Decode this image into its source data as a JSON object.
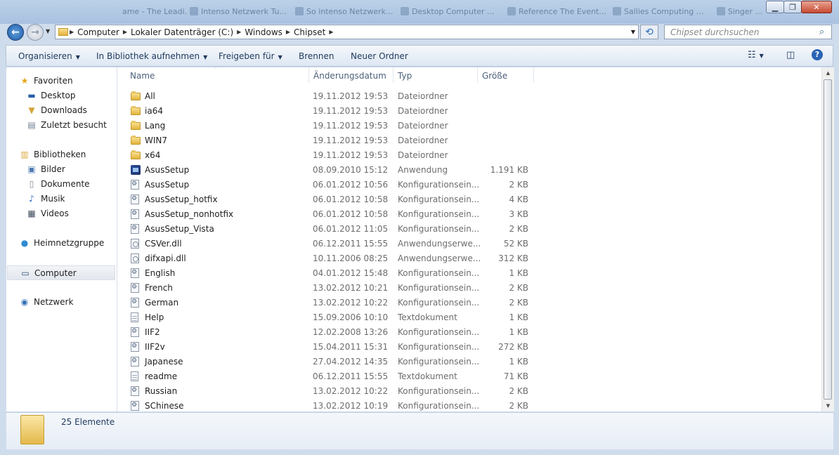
{
  "background_tabs": [
    "ame - The Leadi...",
    "Intenso Netzwerk Tu...",
    "So intenso Netzwerk...",
    "Desktop Computer ...",
    "Reference The Event...",
    "Sallies Computing ...",
    "Singer ..."
  ],
  "address": {
    "crumbs": [
      "Computer",
      "Lokaler Datenträger (C:)",
      "Windows",
      "Chipset"
    ],
    "search_placeholder": "Chipset durchsuchen"
  },
  "toolbar": {
    "organize": "Organisieren",
    "include_library": "In Bibliothek aufnehmen",
    "share": "Freigeben für",
    "burn": "Brennen",
    "new_folder": "Neuer Ordner"
  },
  "nav": {
    "favorites": "Favoriten",
    "desktop": "Desktop",
    "downloads": "Downloads",
    "recent": "Zuletzt besucht",
    "libraries": "Bibliotheken",
    "pictures": "Bilder",
    "documents": "Dokumente",
    "music": "Musik",
    "videos": "Videos",
    "homegroup": "Heimnetzgruppe",
    "computer": "Computer",
    "network": "Netzwerk"
  },
  "columns": {
    "name": "Name",
    "date": "Änderungsdatum",
    "type": "Typ",
    "size": "Größe"
  },
  "files": [
    {
      "icon": "folder",
      "name": "All",
      "date": "19.11.2012 19:53",
      "type": "Dateiordner",
      "size": ""
    },
    {
      "icon": "folder",
      "name": "ia64",
      "date": "19.11.2012 19:53",
      "type": "Dateiordner",
      "size": ""
    },
    {
      "icon": "folder",
      "name": "Lang",
      "date": "19.11.2012 19:53",
      "type": "Dateiordner",
      "size": ""
    },
    {
      "icon": "folder",
      "name": "WIN7",
      "date": "19.11.2012 19:53",
      "type": "Dateiordner",
      "size": ""
    },
    {
      "icon": "folder",
      "name": "x64",
      "date": "19.11.2012 19:53",
      "type": "Dateiordner",
      "size": ""
    },
    {
      "icon": "app",
      "name": "AsusSetup",
      "date": "08.09.2010 15:12",
      "type": "Anwendung",
      "size": "1.191 KB"
    },
    {
      "icon": "cfg",
      "name": "AsusSetup",
      "date": "06.01.2012 10:56",
      "type": "Konfigurationsein...",
      "size": "2 KB"
    },
    {
      "icon": "cfg",
      "name": "AsusSetup_hotfix",
      "date": "06.01.2012 10:58",
      "type": "Konfigurationsein...",
      "size": "4 KB"
    },
    {
      "icon": "cfg",
      "name": "AsusSetup_nonhotfix",
      "date": "06.01.2012 10:58",
      "type": "Konfigurationsein...",
      "size": "3 KB"
    },
    {
      "icon": "cfg",
      "name": "AsusSetup_Vista",
      "date": "06.01.2012 11:05",
      "type": "Konfigurationsein...",
      "size": "2 KB"
    },
    {
      "icon": "dll",
      "name": "CSVer.dll",
      "date": "06.12.2011 15:55",
      "type": "Anwendungserwe...",
      "size": "52 KB"
    },
    {
      "icon": "dll",
      "name": "difxapi.dll",
      "date": "10.11.2006 08:25",
      "type": "Anwendungserwe...",
      "size": "312 KB"
    },
    {
      "icon": "cfg",
      "name": "English",
      "date": "04.01.2012 15:48",
      "type": "Konfigurationsein...",
      "size": "1 KB"
    },
    {
      "icon": "cfg",
      "name": "French",
      "date": "13.02.2012 10:21",
      "type": "Konfigurationsein...",
      "size": "2 KB"
    },
    {
      "icon": "cfg",
      "name": "German",
      "date": "13.02.2012 10:22",
      "type": "Konfigurationsein...",
      "size": "2 KB"
    },
    {
      "icon": "txt",
      "name": "Help",
      "date": "15.09.2006 10:10",
      "type": "Textdokument",
      "size": "1 KB"
    },
    {
      "icon": "cfg",
      "name": "IIF2",
      "date": "12.02.2008 13:26",
      "type": "Konfigurationsein...",
      "size": "1 KB"
    },
    {
      "icon": "cfg",
      "name": "IIF2v",
      "date": "15.04.2011 15:31",
      "type": "Konfigurationsein...",
      "size": "272 KB"
    },
    {
      "icon": "cfg",
      "name": "Japanese",
      "date": "27.04.2012 14:35",
      "type": "Konfigurationsein...",
      "size": "1 KB"
    },
    {
      "icon": "txt",
      "name": "readme",
      "date": "06.12.2011 15:55",
      "type": "Textdokument",
      "size": "71 KB"
    },
    {
      "icon": "cfg",
      "name": "Russian",
      "date": "13.02.2012 10:22",
      "type": "Konfigurationsein...",
      "size": "2 KB"
    },
    {
      "icon": "cfg",
      "name": "SChinese",
      "date": "13.02.2012 10:19",
      "type": "Konfigurationsein...",
      "size": "2 KB"
    }
  ],
  "status": {
    "count": "25 Elemente"
  }
}
